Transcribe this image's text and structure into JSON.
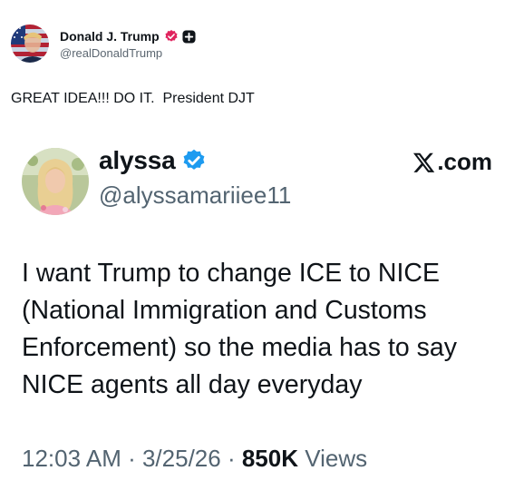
{
  "outer_post": {
    "author": {
      "display_name": "Donald J. Trump",
      "handle": "@realDonaldTrump",
      "verified_badge_icon": "verified-badge-icon",
      "extra_badge_icon": "plus-badge-icon",
      "avatar": "avatar-flag-portrait"
    },
    "text": "GREAT IDEA!!! DO IT.  President DJT"
  },
  "embedded_tweet": {
    "author": {
      "display_name": "alyssa",
      "handle": "@alyssamariiee11",
      "verified_badge_icon": "verified-badge-icon",
      "avatar": "avatar-portrait"
    },
    "brand": {
      "logo_icon": "x-logo-icon",
      "domain_text": ".com"
    },
    "body_lines": [
      "I want Trump to change ICE to NICE",
      "(National Immigration and Customs",
      "Enforcement) so the media has to say",
      "NICE agents all day everyday"
    ],
    "meta": {
      "time": "12:03 AM",
      "separator": " · ",
      "date": "3/25/26",
      "views_count": "850K",
      "views_label": " Views"
    }
  },
  "colors": {
    "verified_pink": "#e0245e",
    "verified_blue": "#1d9bf0",
    "text_primary": "#0f1419",
    "text_secondary": "#536471"
  }
}
